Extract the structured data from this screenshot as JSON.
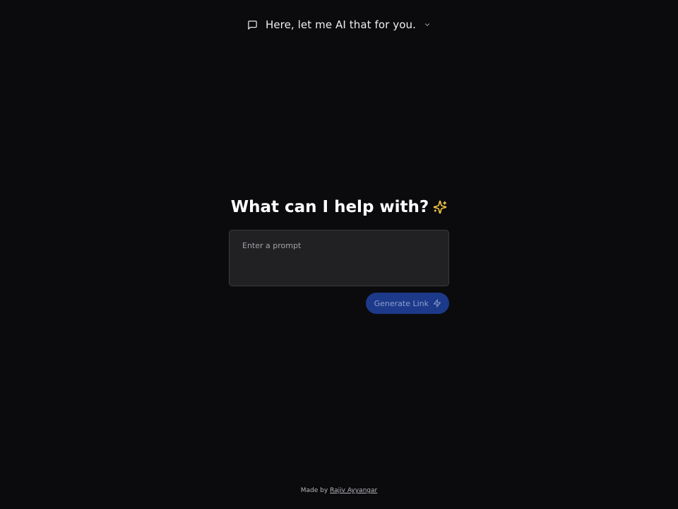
{
  "header": {
    "title": "Here, let me AI that for you.",
    "icon": "message-square-icon",
    "dropdown_icon": "chevron-down-icon"
  },
  "main": {
    "heading": "What can I help with?",
    "heading_icon": "sparkles-icon",
    "prompt_placeholder": "Enter a prompt",
    "prompt_value": "",
    "generate_label": "Generate Link",
    "generate_icon": "zap-icon"
  },
  "footer": {
    "prefix": "Made by",
    "author": "Rajiv Ayyangar"
  },
  "colors": {
    "background": "#0b0b0e",
    "input_bg": "#212124",
    "button_bg": "#1d3a8a",
    "sparkle": "#f5c542"
  }
}
